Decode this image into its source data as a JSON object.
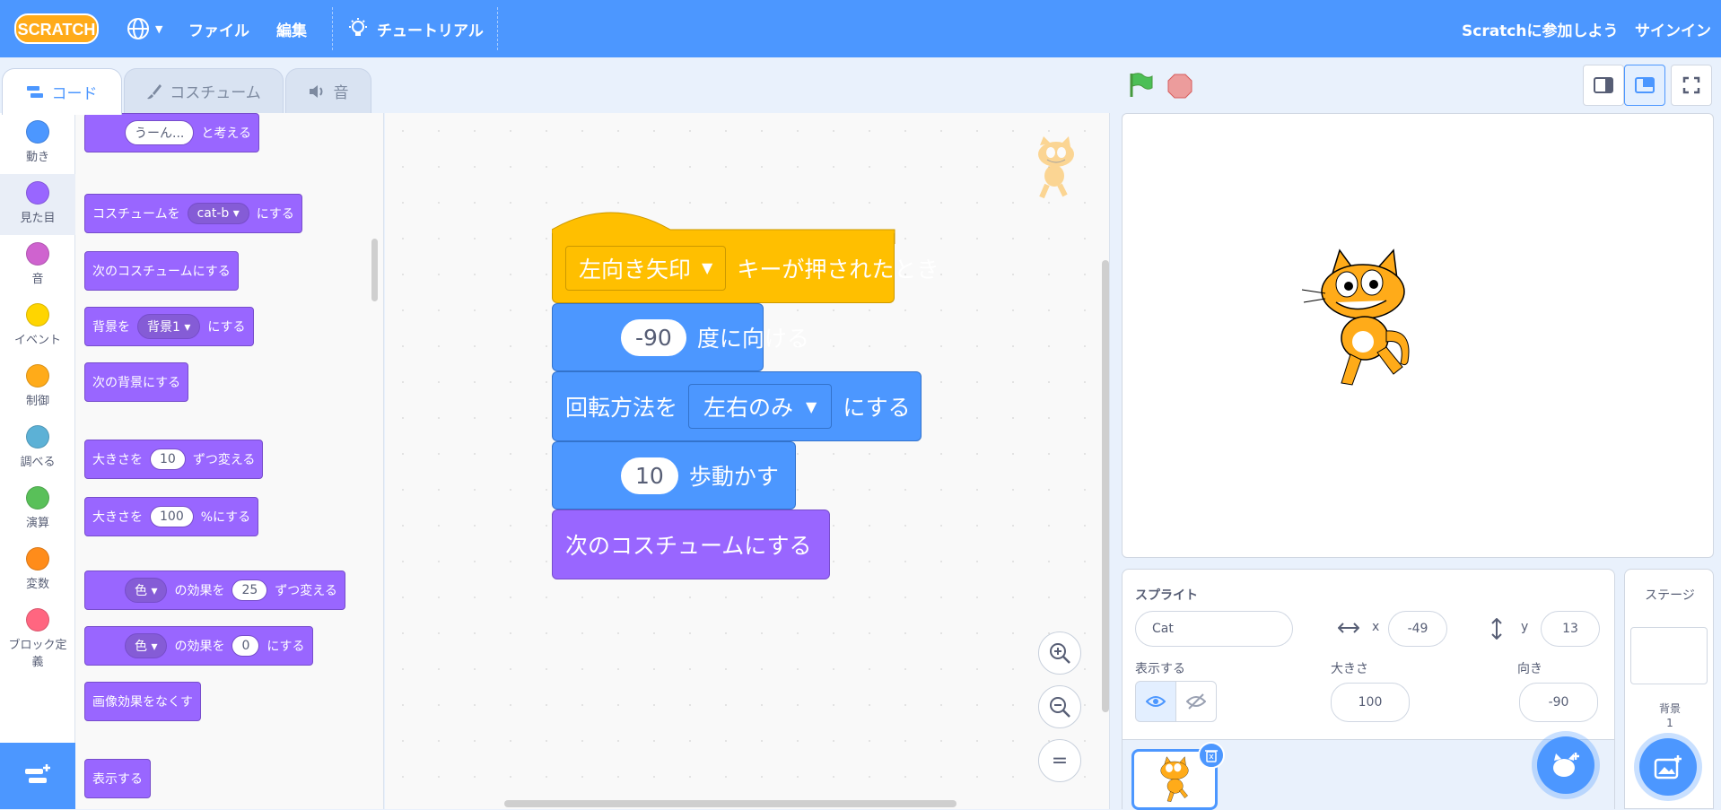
{
  "menu": {
    "logo": "SCRATCH",
    "file": "ファイル",
    "edit": "編集",
    "tutorials": "チュートリアル",
    "join": "Scratchに参加しよう",
    "signin": "サインイン"
  },
  "tabs": [
    {
      "label": "コード"
    },
    {
      "label": "コスチューム"
    },
    {
      "label": "音"
    }
  ],
  "categories": [
    {
      "label": "動き",
      "color": "#4c97ff"
    },
    {
      "label": "見た目",
      "color": "#9966ff"
    },
    {
      "label": "音",
      "color": "#cf63cf"
    },
    {
      "label": "イベント",
      "color": "#ffd500"
    },
    {
      "label": "制御",
      "color": "#ffab19"
    },
    {
      "label": "調べる",
      "color": "#5cb1d6"
    },
    {
      "label": "演算",
      "color": "#59c059"
    },
    {
      "label": "変数",
      "color": "#ff8c1a"
    },
    {
      "label": "ブロック定",
      "label2": "義",
      "color": "#ff6680"
    }
  ],
  "palette": {
    "think_input": "うーん...",
    "think_text": "と考える",
    "switch_costume_pre": "コスチュームを",
    "switch_costume_val": "cat-b",
    "switch_costume_post": "にする",
    "next_costume": "次のコスチュームにする",
    "switch_backdrop_pre": "背景を",
    "switch_backdrop_val": "背景1",
    "switch_backdrop_post": "にする",
    "next_backdrop": "次の背景にする",
    "change_size_pre": "大きさを",
    "change_size_val": "10",
    "change_size_post": "ずつ変える",
    "set_size_pre": "大きさを",
    "set_size_val": "100",
    "set_size_post": "%にする",
    "change_effect_val": "色",
    "change_effect_mid": "の効果を",
    "change_effect_num": "25",
    "change_effect_post": "ずつ変える",
    "set_effect_val": "色",
    "set_effect_mid": "の効果を",
    "set_effect_num": "0",
    "set_effect_post": "にする",
    "clear_effects": "画像効果をなくす",
    "show": "表示する"
  },
  "script": {
    "hat_key": "左向き矢印",
    "hat_text": "キーが押されたとき",
    "point_val": "-90",
    "point_text": "度に向ける",
    "rot_pre": "回転方法を",
    "rot_val": "左右のみ",
    "rot_post": "にする",
    "move_val": "10",
    "move_text": "歩動かす",
    "next_costume": "次のコスチュームにする"
  },
  "zoom": {
    "reset": "="
  },
  "sprite_info": {
    "title": "スプライト",
    "name": "Cat",
    "x_label": "x",
    "x": "-49",
    "y_label": "y",
    "y": "13",
    "show_label": "表示する",
    "size_label": "大きさ",
    "size": "100",
    "direction_label": "向き",
    "direction": "-90"
  },
  "stage_panel": {
    "title": "ステージ",
    "backdrops_label": "背景",
    "backdrops_count": "1"
  },
  "colors": {
    "menubar": "#4c97ff",
    "motion": "#4c97ff",
    "looks": "#9966ff",
    "events": "#ffbf00"
  }
}
